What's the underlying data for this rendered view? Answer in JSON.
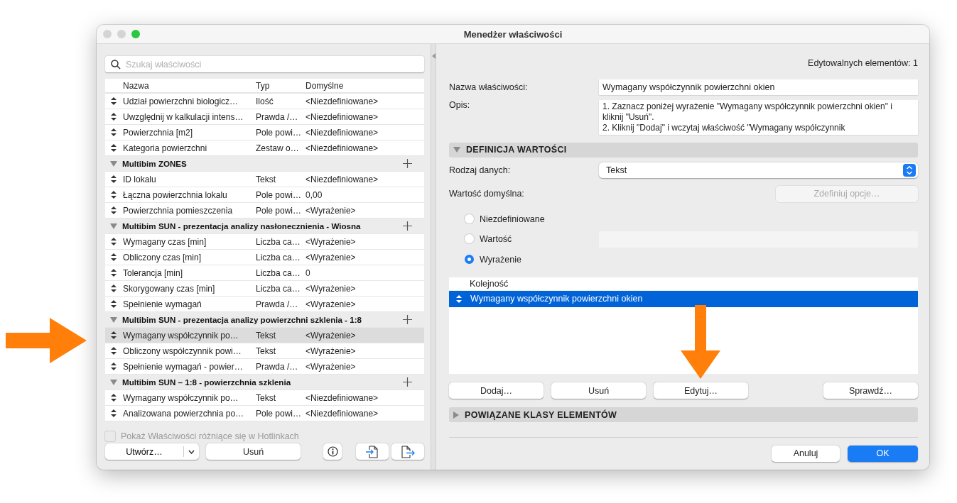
{
  "window": {
    "title": "Menedżer właściwości"
  },
  "left": {
    "search": {
      "placeholder": "Szukaj właściwości"
    },
    "columns": [
      "Nazwa",
      "Typ",
      "Domyślne"
    ],
    "rows": [
      {
        "kind": "property",
        "name": "Udział powierzchni biologicz…",
        "type": "Ilość",
        "default": "<Niezdefiniowane>",
        "selected": false
      },
      {
        "kind": "property",
        "name": "Uwzględnij w kalkulacji intens…",
        "type": "Prawda /…",
        "default": "<Niezdefiniowane>",
        "selected": false
      },
      {
        "kind": "property",
        "name": "Powierzchnia [m2]",
        "type": "Pole powi…",
        "default": "<Niezdefiniowane>",
        "selected": false
      },
      {
        "kind": "property",
        "name": "Kategoria powierzchni",
        "type": "Zestaw o…",
        "default": "<Niezdefiniowane>",
        "selected": false
      },
      {
        "kind": "group",
        "name": "Multibim ZONES",
        "expanded": true
      },
      {
        "kind": "property",
        "name": "ID lokalu",
        "type": "Tekst",
        "default": "<Niezdefiniowane>",
        "selected": false
      },
      {
        "kind": "property",
        "name": "Łączna powierzchnia lokalu",
        "type": "Pole powi…",
        "default": "0,00",
        "selected": false
      },
      {
        "kind": "property",
        "name": "Powierzchnia pomieszczenia",
        "type": "Pole powi…",
        "default": "<Wyrażenie>",
        "selected": false
      },
      {
        "kind": "group",
        "name": "Multibim SUN - prezentacja analizy nasłonecznienia - Wiosna",
        "expanded": true
      },
      {
        "kind": "property",
        "name": "Wymagany czas [min]",
        "type": "Liczba ca…",
        "default": "<Wyrażenie>",
        "selected": false
      },
      {
        "kind": "property",
        "name": "Obliczony czas [min]",
        "type": "Liczba ca…",
        "default": "<Wyrażenie>",
        "selected": false
      },
      {
        "kind": "property",
        "name": "Tolerancja [min]",
        "type": "Liczba ca…",
        "default": "0",
        "selected": false
      },
      {
        "kind": "property",
        "name": "Skorygowany czas [min]",
        "type": "Liczba ca…",
        "default": "<Wyrażenie>",
        "selected": false
      },
      {
        "kind": "property",
        "name": "Spełnienie wymagań",
        "type": "Prawda /…",
        "default": "<Wyrażenie>",
        "selected": false
      },
      {
        "kind": "group",
        "name": "Multibim SUN - prezentacja analizy powierzchni szklenia - 1:8",
        "expanded": true
      },
      {
        "kind": "property",
        "name": "Wymagany współczynnik po…",
        "type": "Tekst",
        "default": "<Wyrażenie>",
        "selected": true
      },
      {
        "kind": "property",
        "name": "Obliczony współczynnik powi…",
        "type": "Tekst",
        "default": "<Wyrażenie>",
        "selected": false
      },
      {
        "kind": "property",
        "name": "Spełnienie wymagań - powier…",
        "type": "Prawda /…",
        "default": "<Wyrażenie>",
        "selected": false
      },
      {
        "kind": "group",
        "name": "Multibim SUN – 1:8 - powierzchnia szklenia",
        "expanded": true
      },
      {
        "kind": "property",
        "name": "Wymagany współczynnik po…",
        "type": "Tekst",
        "default": "<Niezdefiniowane>",
        "selected": false
      },
      {
        "kind": "property",
        "name": "Analizowana powierzchnia po…",
        "type": "Pole powi…",
        "default": "<Niezdefiniowane>",
        "selected": false
      }
    ],
    "hotlinks_checkbox": {
      "label": "Pokaż Właściwości różniące się w Hotlinkach",
      "checked": false,
      "disabled": true
    },
    "create_button": "Utwórz…",
    "delete_button": "Usuń"
  },
  "right": {
    "editable_count": "Edytowalnych elementów: 1",
    "name_field": {
      "label": "Nazwa właściwości:",
      "value": "Wymagany współczynnik powierzchni okien"
    },
    "description": {
      "label": "Opis:",
      "value": "1. Zaznacz poniżej wyrażenie \"Wymagany współczynnik powierzchni okien\" i kliknij \"Usuń\".\n2. Kliknij \"Dodaj\" i wczytaj właściwość \"Wymagany współczynnik"
    },
    "value_section": {
      "title": "DEFINICJA WARTOŚCI",
      "expanded": true
    },
    "data_type": {
      "label": "Rodzaj danych:",
      "value": "Tekst"
    },
    "default_value": {
      "label": "Wartość domyślna:",
      "options_button": {
        "label": "Zdefiniuj opcje…",
        "disabled": true
      },
      "options": [
        {
          "label": "Niezdefiniowane",
          "selected": false
        },
        {
          "label": "Wartość",
          "selected": false
        },
        {
          "label": "Wyrażenie",
          "selected": true
        }
      ]
    },
    "order_list": {
      "header": "Kolejność",
      "rows": [
        {
          "text": "Wymagany współczynnik powierzchni okien",
          "selected": true
        }
      ]
    },
    "list_buttons": [
      "Dodaj…",
      "Usuń",
      "Edytuj…",
      "Sprawdź…"
    ],
    "classes_section": {
      "title": "POWIĄZANE KLASY ELEMENTÓW",
      "expanded": false
    },
    "footer_buttons": [
      {
        "label": "Anuluj",
        "kind": "secondary"
      },
      {
        "label": "OK",
        "kind": "primary"
      }
    ]
  }
}
